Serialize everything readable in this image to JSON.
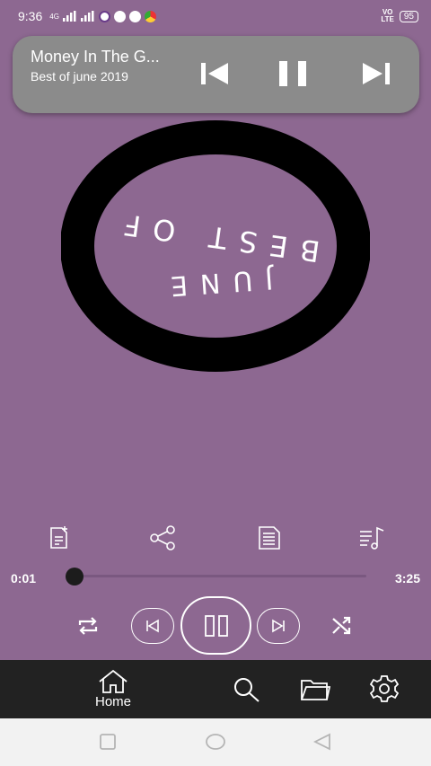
{
  "status_bar": {
    "time": "9:36",
    "network": "4G",
    "volte": "VoLTE",
    "battery": "95"
  },
  "now_playing": {
    "title": "Money In The G...",
    "subtitle": "Best of june 2019",
    "icons": [
      "previous-icon",
      "pause-icon",
      "next-icon"
    ]
  },
  "album_art": {
    "lines": [
      "BEST OF",
      "JUNE"
    ],
    "colors": {
      "ring": "#000000",
      "inner": "#8d6891"
    }
  },
  "actions": [
    "add-to-playlist-icon",
    "share-icon",
    "lyrics-icon",
    "queue-icon"
  ],
  "progress": {
    "current": "0:01",
    "total": "3:25",
    "fraction": 0.005
  },
  "controls": [
    "repeat-icon",
    "previous-icon",
    "pause-icon",
    "next-icon",
    "shuffle-icon"
  ],
  "bottom_nav": {
    "home_label": "Home",
    "items": [
      "home-icon",
      "search-icon",
      "folder-icon",
      "settings-icon"
    ]
  },
  "colors": {
    "background": "#8d6891",
    "card": "#8b8b8b",
    "nav_bar": "#222222",
    "system_bar": "#f2f2f2"
  }
}
